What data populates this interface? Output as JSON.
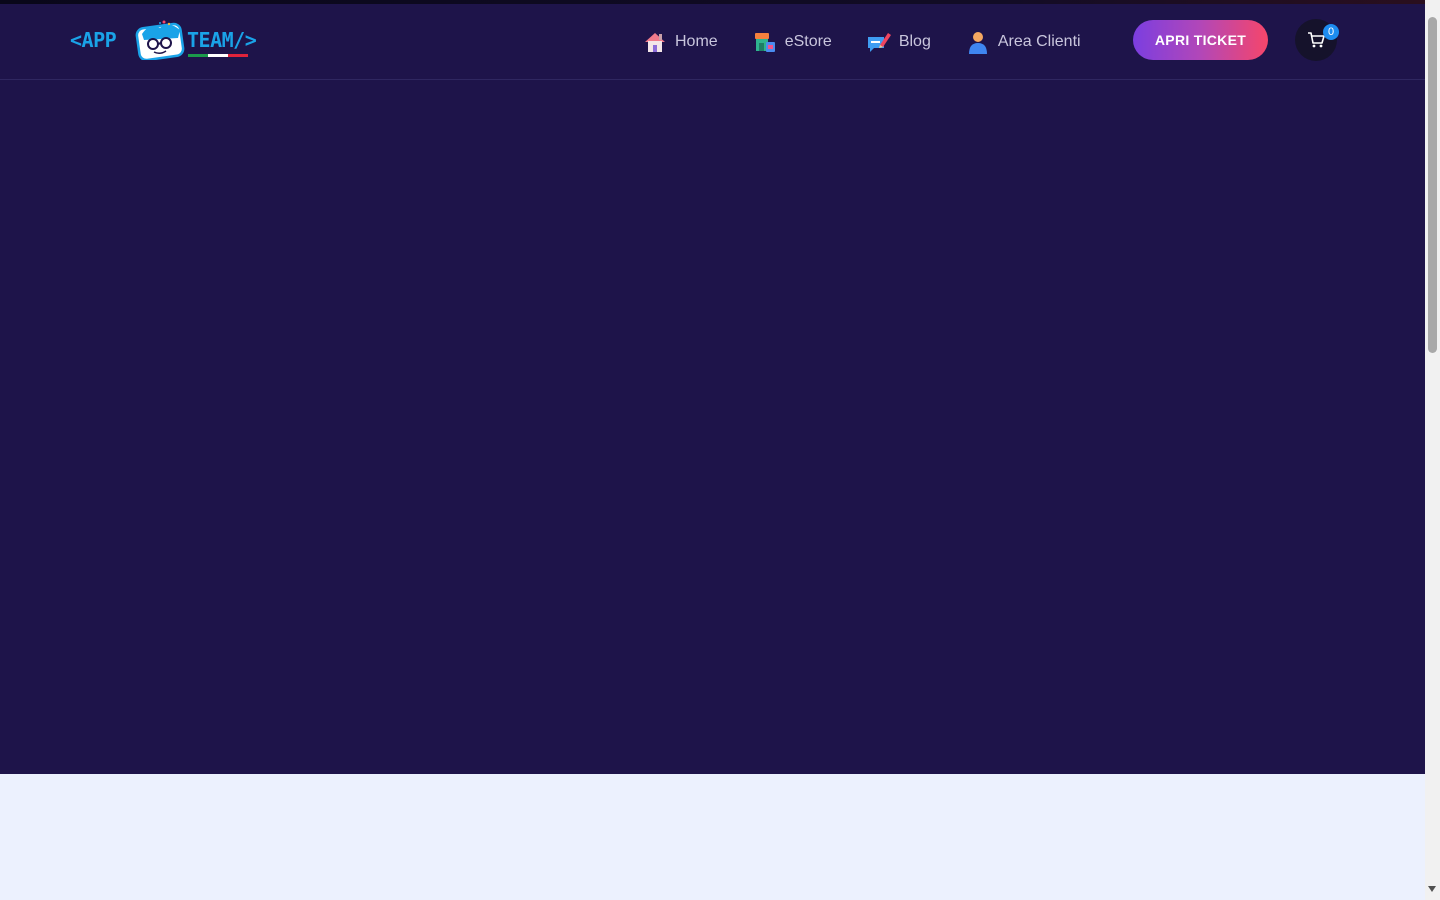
{
  "header": {
    "logo": {
      "text_left": "<APP",
      "text_right": "TEAM/>",
      "brand_color": "#1aa3e8"
    },
    "nav": [
      {
        "label": "Home",
        "icon": "house-icon"
      },
      {
        "label": "eStore",
        "icon": "store-icon"
      },
      {
        "label": "Blog",
        "icon": "chat-pencil-icon"
      },
      {
        "label": "Area Clienti",
        "icon": "user-icon"
      }
    ],
    "ticket_button": {
      "label": "APRI TICKET"
    },
    "cart": {
      "count": "0",
      "icon": "cart-icon"
    }
  },
  "colors": {
    "header_bg": "#1e144a",
    "hero_bg": "#1e144a",
    "below_bg": "#ecf1fe",
    "badge": "#1d8cf0",
    "gradient_start": "#7b3ee0",
    "gradient_end": "#f6466a"
  }
}
